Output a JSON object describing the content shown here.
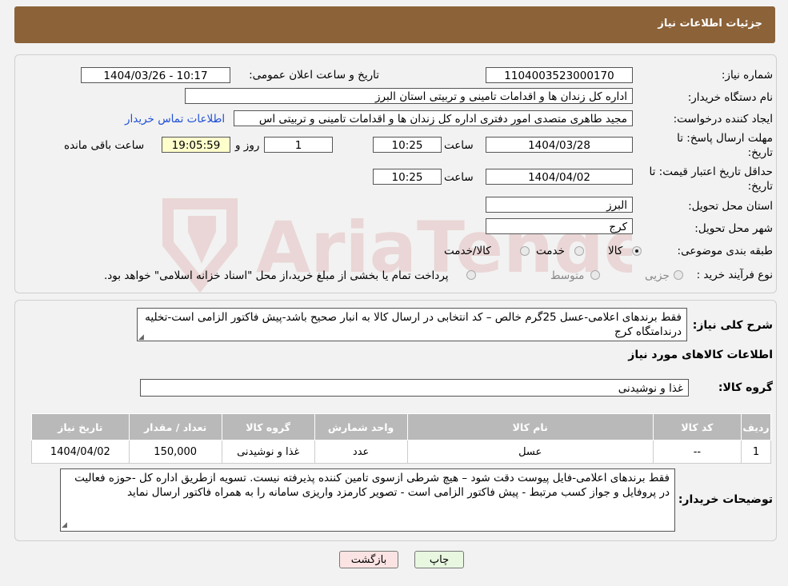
{
  "header": {
    "title": "جزئیات اطلاعات نیاز"
  },
  "form": {
    "need_number_label": "شماره نیاز:",
    "need_number": "1104003523000170",
    "announce_label": "تاریخ و ساعت اعلان عمومی:",
    "announce_value": "1404/03/26 - 10:17",
    "buyer_org_label": "نام دستگاه خریدار:",
    "buyer_org": "اداره کل زندان ها و اقدامات تامینی و تربیتی استان البرز",
    "requester_label": "ایجاد کننده درخواست:",
    "requester": "مجید طاهری متصدی امور دفتری اداره کل زندان ها و اقدامات تامینی و تربیتی اس",
    "contact_link": "اطلاعات تماس خریدار",
    "deadline_label_1": "مهلت ارسال پاسخ: تا",
    "deadline_label_2": "تاریخ:",
    "deadline_date": "1404/03/28",
    "time_label": "ساعت",
    "deadline_time": "10:25",
    "days_value": "1",
    "days_label": "روز و",
    "remaining_time": "19:05:59",
    "remaining_label": "ساعت باقی مانده",
    "validity_label_1": "حداقل تاریخ اعتبار قیمت: تا",
    "validity_label_2": "تاریخ:",
    "validity_date": "1404/04/02",
    "validity_time_label": "ساعت",
    "validity_time": "10:25",
    "province_label": "استان محل تحویل:",
    "province": "البرز",
    "city_label": "شهر محل تحویل:",
    "city": "کرج",
    "category_label": "طبقه بندی موضوعی:",
    "category_options": [
      "کالا",
      "خدمت",
      "کالا/خدمت"
    ],
    "category_selected": "کالا",
    "process_label": "نوع فرآیند خرید :",
    "process_options": [
      "جزیی",
      "متوسط"
    ],
    "process_note": "پرداخت تمام یا بخشی از مبلغ خرید،از محل \"اسناد خزانه اسلامی\" خواهد بود."
  },
  "description": {
    "label": "شرح کلی نیاز:",
    "text": "فقط برندهای اعلامی-عسل 25گرم خالص – کد انتخابی در ارسال کالا به انبار صحیح باشد-پیش فاکتور الزامی است-تخلیه درندامتگاه کرج",
    "goods_section_title": "اطلاعات کالاهای مورد نیاز",
    "goods_group_label": "گروه کالا:",
    "goods_group": "غذا و نوشیدنی"
  },
  "table": {
    "headers": [
      "ردیف",
      "کد کالا",
      "نام کالا",
      "واحد شمارش",
      "گروه کالا",
      "تعداد / مقدار",
      "تاریخ نیاز"
    ],
    "rows": [
      [
        "1",
        "--",
        "عسل",
        "عدد",
        "غذا و نوشیدنی",
        "150,000",
        "1404/04/02"
      ]
    ]
  },
  "buyer_notes": {
    "label": "توضیحات خریدار:",
    "text": "فقط برندهای اعلامی-فایل پیوست دقت شود – هیچ شرطی ازسوی تامین کننده پذیرفته نیست. تسویه ازطریق اداره کل -حوزه فعالیت در پروفایل و جواز کسب مرتبط - پیش فاکتور الزامی است - تصویر کارمزد واریزی سامانه را به همراه فاکتور ارسال نماید"
  },
  "buttons": {
    "print": "چاپ",
    "back": "بازگشت"
  },
  "colors": {
    "header_bg": "#8c6239",
    "link": "#1f4fd6",
    "back_button_bg": "#fbe3e3",
    "print_button_bg": "#e8f7e0"
  }
}
